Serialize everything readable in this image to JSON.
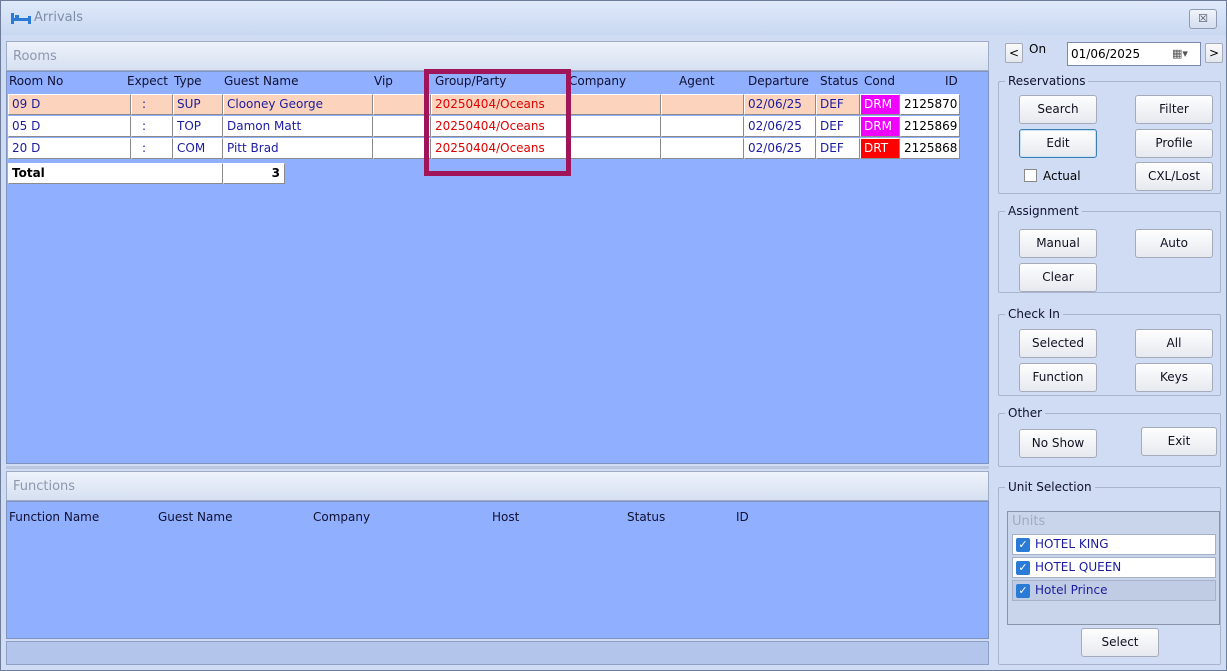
{
  "window": {
    "title": "Arrivals",
    "close_glyph": "☒"
  },
  "rooms": {
    "header": "Rooms",
    "columns": [
      "Room No",
      "Expect",
      "Type",
      "Guest Name",
      "Vip",
      "Group/Party",
      "Company",
      "Agent",
      "Departure",
      "Status",
      "Cond",
      "ID"
    ],
    "rows": [
      {
        "room": "09 D",
        "expect": ":",
        "type": "SUP",
        "guest": "Clooney George",
        "vip": "",
        "group": "20250404/Oceans",
        "company": "",
        "agent": "",
        "departure": "02/06/25",
        "status": "DEF",
        "cond": "DRM",
        "id": "2125870"
      },
      {
        "room": "05 D",
        "expect": ":",
        "type": "TOP",
        "guest": "Damon Matt",
        "vip": "",
        "group": "20250404/Oceans",
        "company": "",
        "agent": "",
        "departure": "02/06/25",
        "status": "DEF",
        "cond": "DRM",
        "id": "2125869"
      },
      {
        "room": "20 D",
        "expect": ":",
        "type": "COM",
        "guest": "Pitt Brad",
        "vip": "",
        "group": "20250404/Oceans",
        "company": "",
        "agent": "",
        "departure": "02/06/25",
        "status": "DEF",
        "cond": "DRT",
        "id": "2125868"
      }
    ],
    "total_label": "Total",
    "total_value": "3"
  },
  "functions": {
    "header": "Functions",
    "columns": [
      "Function Name",
      "Guest Name",
      "Company",
      "Host",
      "Status",
      "ID"
    ]
  },
  "date_nav": {
    "prev": "<",
    "next": ">",
    "on_label": "On",
    "date": "01/06/2025",
    "dropdown_glyph": "▦▾"
  },
  "reservations": {
    "label": "Reservations",
    "search": "Search",
    "filter": "Filter",
    "edit": "Edit",
    "profile": "Profile",
    "actual": "Actual",
    "cxl_lost": "CXL/Lost"
  },
  "assignment": {
    "label": "Assignment",
    "manual": "Manual",
    "auto": "Auto",
    "clear": "Clear"
  },
  "check_in": {
    "label": "Check In",
    "selected": "Selected",
    "all": "All",
    "function": "Function",
    "keys": "Keys"
  },
  "other": {
    "label": "Other",
    "no_show": "No Show",
    "exit": "Exit"
  },
  "unit_selection": {
    "label": "Unit Selection",
    "units_header": "Units",
    "units": [
      {
        "name": "HOTEL KING",
        "checked": true
      },
      {
        "name": "HOTEL QUEEN",
        "checked": true
      },
      {
        "name": "Hotel Prince",
        "checked": true
      }
    ],
    "select": "Select"
  },
  "colors": {
    "grid_bg": "#90afff",
    "selected_row": "#fcd3bc",
    "group_text": "#e00000",
    "drm": "#f000ff",
    "drt": "#ff0000",
    "highlight": "#a01459"
  }
}
